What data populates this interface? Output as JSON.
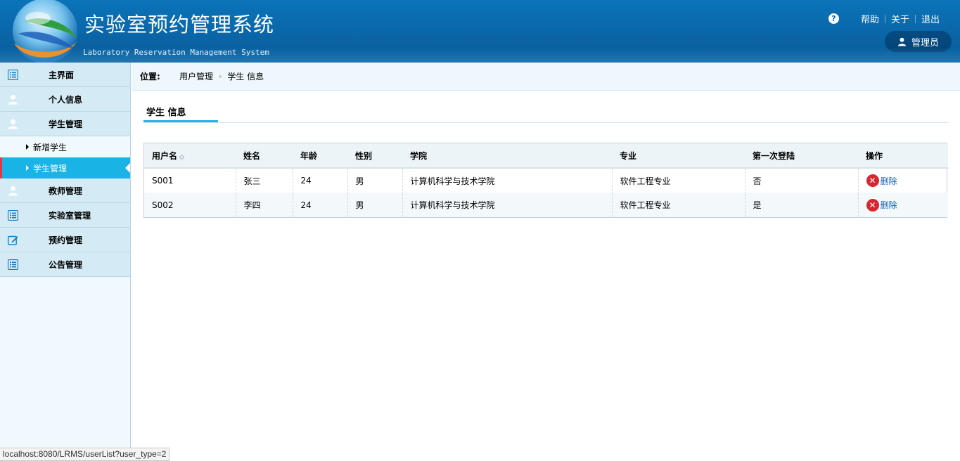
{
  "header": {
    "title": "实验室预约管理系统",
    "subtitle": "Laboratory Reservation Management System",
    "help_icon_glyph": "?",
    "links": [
      {
        "label": "帮助"
      },
      {
        "label": "关于"
      },
      {
        "label": "退出"
      }
    ],
    "user_label": "管理员"
  },
  "sidebar": {
    "items": [
      {
        "label": "主界面",
        "icon": "list-icon"
      },
      {
        "label": "个人信息",
        "icon": "user-icon"
      },
      {
        "label": "学生管理",
        "icon": "user-icon"
      },
      {
        "label": "教师管理",
        "icon": "user-icon"
      },
      {
        "label": "实验室管理",
        "icon": "list-icon"
      },
      {
        "label": "预约管理",
        "icon": "edit-icon"
      },
      {
        "label": "公告管理",
        "icon": "list-icon"
      }
    ],
    "sub_items": [
      {
        "label": "新增学生"
      },
      {
        "label": "学生管理"
      }
    ]
  },
  "location": {
    "label": "位置:",
    "crumbs": [
      "用户管理",
      "学生 信息"
    ]
  },
  "section": {
    "title": "学生 信息"
  },
  "table": {
    "headers": [
      "用户名",
      "姓名",
      "年龄",
      "性别",
      "学院",
      "专业",
      "第一次登陆",
      "操作"
    ],
    "rows": [
      {
        "username": "S001",
        "name": "张三",
        "age": "24",
        "gender": "男",
        "college": "计算机科学与技术学院",
        "major": "软件工程专业",
        "first_login": "否",
        "action": "删除"
      },
      {
        "username": "S002",
        "name": "李四",
        "age": "24",
        "gender": "男",
        "college": "计算机科学与技术学院",
        "major": "软件工程专业",
        "first_login": "是",
        "action": "删除"
      }
    ]
  },
  "status_url": "localhost:8080/LRMS/userList?user_type=2",
  "colors": {
    "header_blue": "#0a6aac",
    "active_blue": "#1ab3e6",
    "active_marker": "#e2364f",
    "delete_red": "#d9262e"
  }
}
